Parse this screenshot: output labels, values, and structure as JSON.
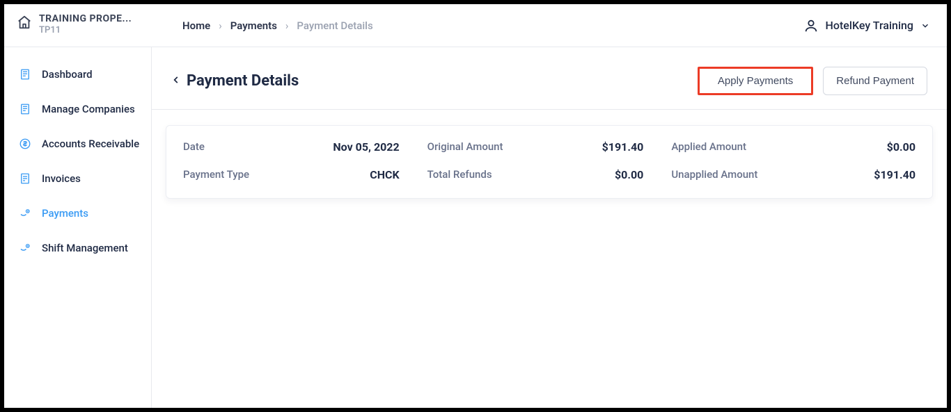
{
  "brand": {
    "title": "TRAINING PROPE...",
    "sub": "TP11"
  },
  "breadcrumb": {
    "home": "Home",
    "parent": "Payments",
    "current": "Payment Details"
  },
  "user": {
    "name": "HotelKey Training"
  },
  "sidebar": {
    "items": [
      {
        "label": "Dashboard"
      },
      {
        "label": "Manage Companies"
      },
      {
        "label": "Accounts Receivable"
      },
      {
        "label": "Invoices"
      },
      {
        "label": "Payments"
      },
      {
        "label": "Shift Management"
      }
    ]
  },
  "page": {
    "title": "Payment Details",
    "apply_btn": "Apply Payments",
    "refund_btn": "Refund Payment"
  },
  "details": {
    "date_label": "Date",
    "date_value": "Nov 05, 2022",
    "ptype_label": "Payment Type",
    "ptype_value": "CHCK",
    "orig_label": "Original Amount",
    "orig_value": "$191.40",
    "refund_label": "Total Refunds",
    "refund_value": "$0.00",
    "applied_label": "Applied Amount",
    "applied_value": "$0.00",
    "unapplied_label": "Unapplied Amount",
    "unapplied_value": "$191.40"
  }
}
